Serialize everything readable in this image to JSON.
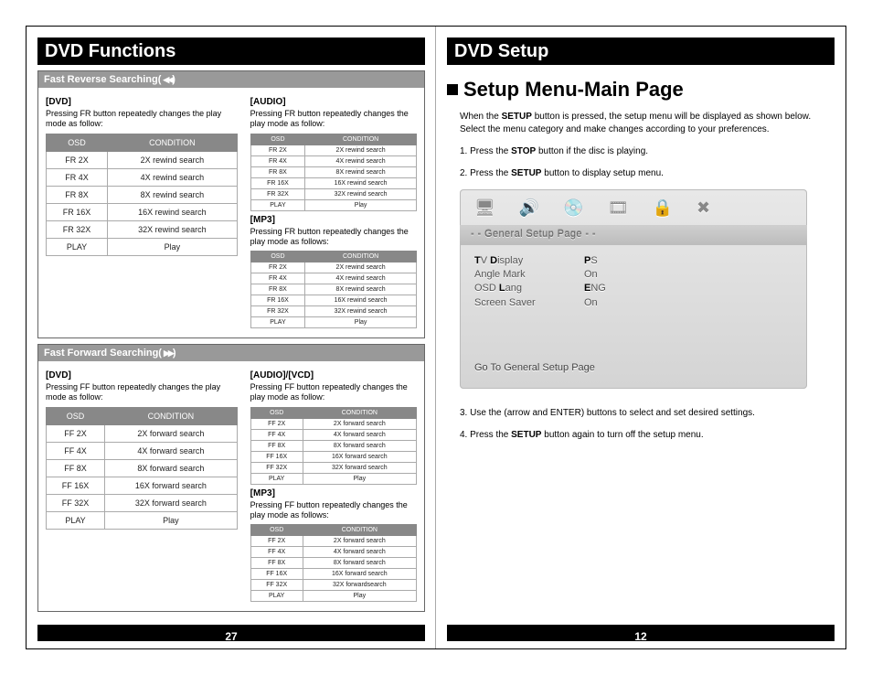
{
  "left": {
    "title": "DVD Functions",
    "pageNumber": "27",
    "sections": [
      {
        "bar": "Fast Reverse Searching(",
        "barIconName": "rewind-icon",
        "barSuffix": ")",
        "groups": [
          {
            "head": "[DVD]",
            "desc": "Pressing FR button repeatedly changes the play mode as follow:",
            "big": true,
            "headers": [
              "OSD",
              "CONDITION"
            ],
            "rows": [
              [
                "FR 2X",
                "2X rewind search"
              ],
              [
                "FR 4X",
                "4X rewind search"
              ],
              [
                "FR 8X",
                "8X rewind search"
              ],
              [
                "FR 16X",
                "16X rewind search"
              ],
              [
                "FR 32X",
                "32X rewind search"
              ],
              [
                "PLAY",
                "Play"
              ]
            ]
          },
          {
            "head": "[AUDIO]",
            "desc": "Pressing FR button repeatedly changes the play mode as follow:",
            "big": false,
            "headers": [
              "OSD",
              "CONDITION"
            ],
            "rows": [
              [
                "FR 2X",
                "2X rewind search"
              ],
              [
                "FR 4X",
                "4X rewind search"
              ],
              [
                "FR 8X",
                "8X rewind search"
              ],
              [
                "FR 16X",
                "16X rewind search"
              ],
              [
                "FR 32X",
                "32X rewind search"
              ],
              [
                "PLAY",
                "Play"
              ]
            ],
            "second": {
              "head": "[MP3]",
              "desc": "Pressing FR button repeatedly changes the play mode as follows:",
              "headers": [
                "OSD",
                "CONDITION"
              ],
              "rows": [
                [
                  "FR 2X",
                  "2X rewind search"
                ],
                [
                  "FR 4X",
                  "4X rewind search"
                ],
                [
                  "FR 8X",
                  "8X rewind search"
                ],
                [
                  "FR 16X",
                  "16X rewind search"
                ],
                [
                  "FR 32X",
                  "32X rewind search"
                ],
                [
                  "PLAY",
                  "Play"
                ]
              ]
            }
          }
        ]
      },
      {
        "bar": "Fast Forward Searching(",
        "barIconName": "fast-forward-icon",
        "barSuffix": ")",
        "groups": [
          {
            "head": "[DVD]",
            "desc": "Pressing FF button repeatedly changes the play mode as follow:",
            "big": true,
            "headers": [
              "OSD",
              "CONDITION"
            ],
            "rows": [
              [
                "FF 2X",
                "2X forward search"
              ],
              [
                "FF 4X",
                "4X forward search"
              ],
              [
                "FF 8X",
                "8X forward search"
              ],
              [
                "FF 16X",
                "16X forward search"
              ],
              [
                "FF 32X",
                "32X forward search"
              ],
              [
                "PLAY",
                "Play"
              ]
            ]
          },
          {
            "head": "[AUDIO]/[VCD]",
            "desc": "Pressing FF button repeatedly changes the play mode as follow:",
            "big": false,
            "headers": [
              "OSD",
              "CONDITION"
            ],
            "rows": [
              [
                "FF 2X",
                "2X forward search"
              ],
              [
                "FF 4X",
                "4X forward search"
              ],
              [
                "FF 8X",
                "8X forward search"
              ],
              [
                "FF 16X",
                "16X forward search"
              ],
              [
                "FF 32X",
                "32X forward search"
              ],
              [
                "PLAY",
                "Play"
              ]
            ],
            "second": {
              "head": "[MP3]",
              "desc": "Pressing FF button repeatedly changes the play mode as follows:",
              "headers": [
                "OSD",
                "CONDITION"
              ],
              "rows": [
                [
                  "FF 2X",
                  "2X forward search"
                ],
                [
                  "FF 4X",
                  "4X forward search"
                ],
                [
                  "FF 8X",
                  "8X forward search"
                ],
                [
                  "FF 16X",
                  "16X forward search"
                ],
                [
                  "FF 32X",
                  "32X forwardsearch"
                ],
                [
                  "PLAY",
                  "Play"
                ]
              ]
            }
          }
        ]
      }
    ]
  },
  "right": {
    "title": "DVD Setup",
    "pageNumber": "12",
    "heading": "Setup Menu-Main Page",
    "intro_a": "When the ",
    "intro_b": "SETUP",
    "intro_c": " button is pressed, the setup menu will be displayed as shown below. Select the menu category and make changes according to your preferences.",
    "step1_a": "1. Press the ",
    "step1_b": "STOP",
    "step1_c": " button if the disc is playing.",
    "step2_a": "2. Press the ",
    "step2_b": "SETUP",
    "step2_c": " button to display setup menu.",
    "step3": "3. Use the (arrow and ENTER) buttons to select and set desired settings.",
    "step4_a": "4. Press the ",
    "step4_b": "SETUP",
    "step4_c": " button again to turn off the setup menu.",
    "osd": {
      "barText": "- - General Setup Page - -",
      "items": [
        {
          "k": "TV Display",
          "v": "PS"
        },
        {
          "k": "Angle Mark",
          "v": "On"
        },
        {
          "k": "OSD Lang",
          "v": "ENG"
        },
        {
          "k": "Screen Saver",
          "v": "On"
        }
      ],
      "footer": "Go To General Setup Page"
    }
  }
}
